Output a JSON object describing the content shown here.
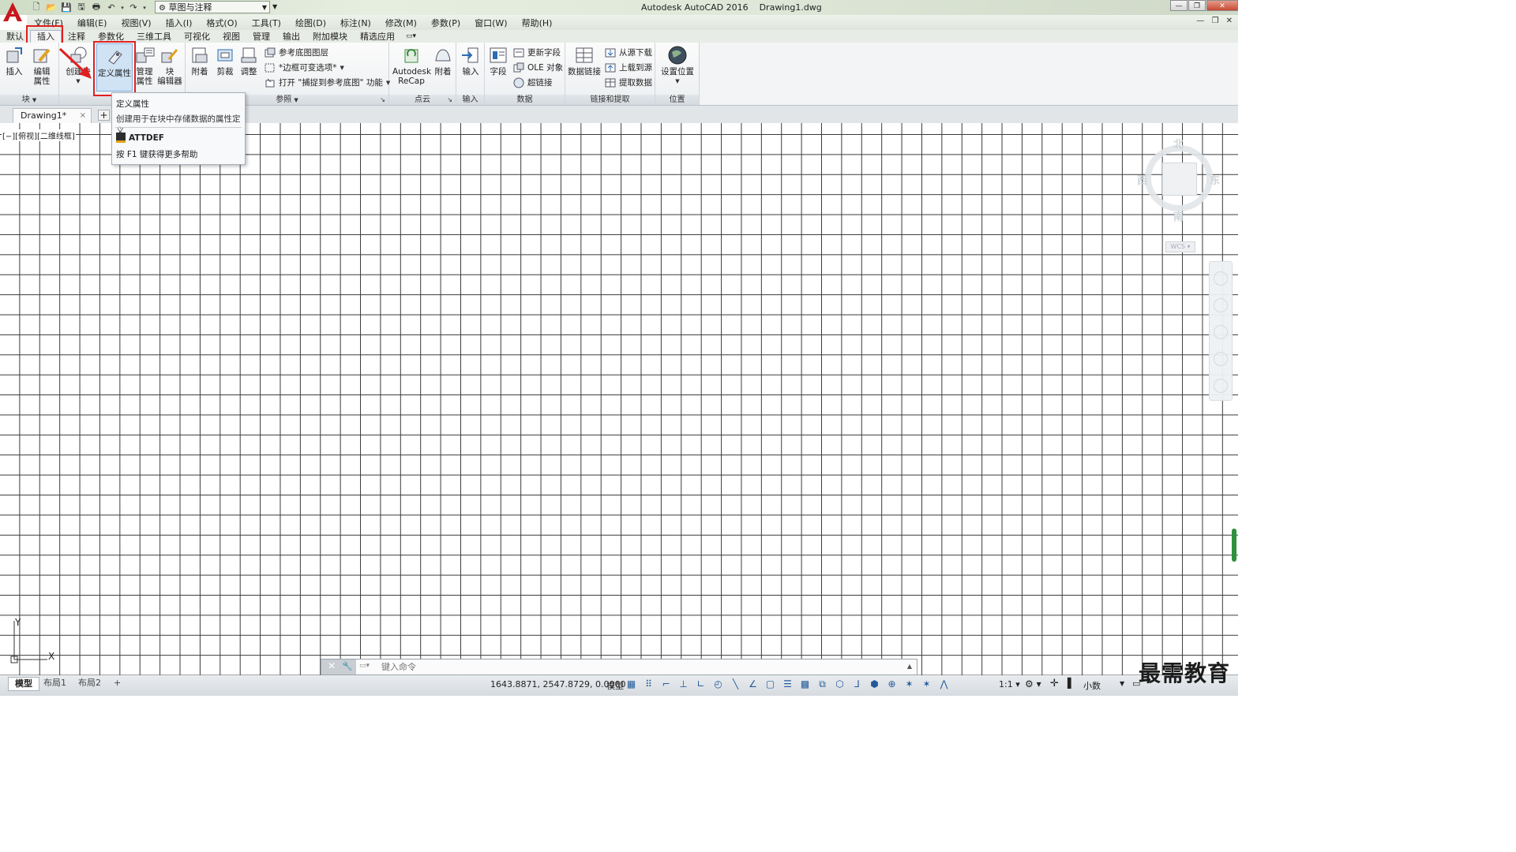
{
  "window": {
    "app_title": "Autodesk AutoCAD 2016    Drawing1.dwg",
    "workspace": "草图与注释"
  },
  "menubar": {
    "items": [
      "文件(F)",
      "编辑(E)",
      "视图(V)",
      "插入(I)",
      "格式(O)",
      "工具(T)",
      "绘图(D)",
      "标注(N)",
      "修改(M)",
      "参数(P)",
      "窗口(W)",
      "帮助(H)"
    ]
  },
  "ribbon_tabs": {
    "items": [
      "默认",
      "插入",
      "注释",
      "参数化",
      "三维工具",
      "可视化",
      "视图",
      "管理",
      "输出",
      "附加模块",
      "精选应用"
    ],
    "active": "插入"
  },
  "ribbon": {
    "block_panel": {
      "insert": "插入",
      "edit_attr_1": "编辑",
      "edit_attr_2": "属性",
      "create_block": "创建块",
      "define_attr": "定义属性",
      "manage_attr_1": "管理",
      "manage_attr_2": "属性",
      "block_editor_1": "块",
      "block_editor_2": "编辑器",
      "footer": "块",
      "footer_def": "块"
    },
    "reference_panel": {
      "attach": "附着",
      "clip": "剪裁",
      "adjust": "调整",
      "underlay_layers": "参考底图图层",
      "frames": "*边框可变选项*",
      "snap": "打开 \"捕捉到参考底图\" 功能",
      "footer": "参照"
    },
    "pointcloud_panel": {
      "recap_1": "Autodesk",
      "recap_2": "ReCap",
      "attach": "附着",
      "footer": "点云"
    },
    "import_panel": {
      "import": "输入",
      "footer": "输入"
    },
    "data_panel": {
      "field": "字段",
      "update_fields": "更新字段",
      "ole": "OLE 对象",
      "hyperlink": "超链接",
      "footer": "数据"
    },
    "linking_panel": {
      "data_link": "数据链接",
      "download": "从源下载",
      "upload": "上载到源",
      "extract": "提取数据",
      "footer": "链接和提取"
    },
    "location_panel": {
      "set_location": "设置位置",
      "footer": "位置"
    }
  },
  "tooltip": {
    "title": "定义属性",
    "description": "创建用于在块中存储数据的属性定义",
    "command": "ATTDEF",
    "help": "按 F1 键获得更多帮助"
  },
  "file_tabs": {
    "drawing": "Drawing1*",
    "close": "×",
    "new": "+"
  },
  "viewport": {
    "label": "[−][俯视][二维线框]",
    "viewcube": {
      "north": "北",
      "south": "南",
      "east": "东",
      "west": "西",
      "wcs": "WCS"
    },
    "ucs_x": "X",
    "ucs_y": "Y"
  },
  "command_line": {
    "placeholder": "键入命令"
  },
  "status_bar": {
    "layouts": [
      "模型",
      "布局1",
      "布局2",
      "+"
    ],
    "coordinates": "1643.8871, 2547.8729, 0.0000",
    "space": "模型",
    "scale": "1:1 ▾",
    "units": "小数"
  },
  "watermark": "最需教育",
  "colors": {
    "highlight": "#e02020",
    "accent_blue": "#245a9a",
    "scroll_green": "#2e8f3e"
  }
}
